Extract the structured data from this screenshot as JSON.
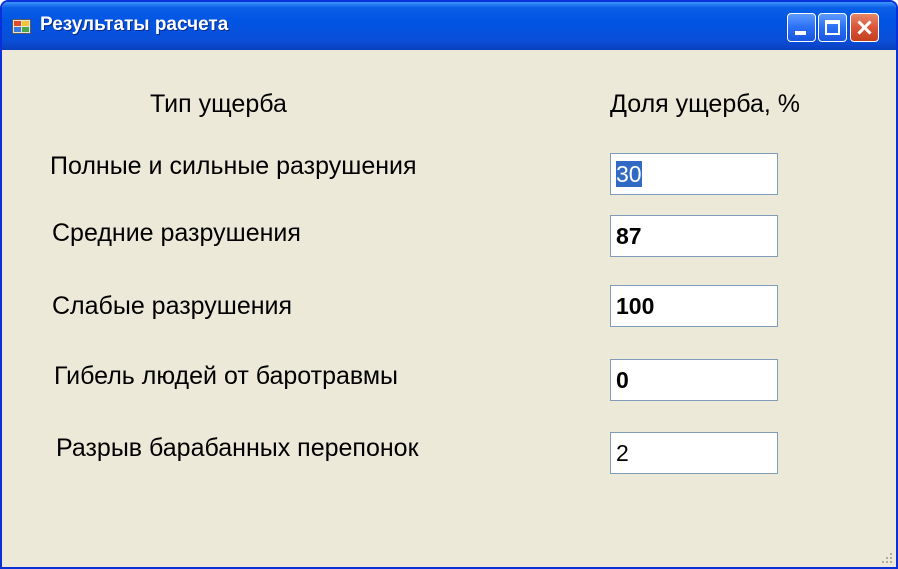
{
  "window": {
    "title": "Результаты расчета"
  },
  "headers": {
    "type": "Тип ущерба",
    "share": "Доля ущерба, %"
  },
  "rows": [
    {
      "label": "Полные и сильные разрушения",
      "value": "30"
    },
    {
      "label": "Средние разрушения",
      "value": "87"
    },
    {
      "label": "Слабые разрушения",
      "value": "100"
    },
    {
      "label": "Гибель людей от баротравмы",
      "value": "0"
    },
    {
      "label": "Разрыв барабанных перепонок",
      "value": "2"
    }
  ],
  "colors": {
    "titlebar": "#0054e3",
    "window_bg": "#ece9d8",
    "selection": "#316ac5"
  }
}
